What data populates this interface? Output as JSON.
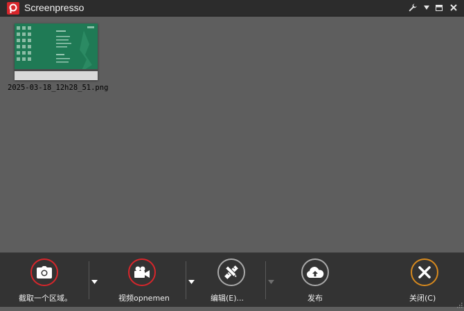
{
  "window": {
    "title": "Screenpresso"
  },
  "title_icons": {
    "logo": "screenpresso-logo-icon",
    "settings": "wrench-icon",
    "menu": "dropdown-arrow-icon",
    "restore": "window-restore-icon",
    "close": "close-icon"
  },
  "gallery": {
    "items": [
      {
        "filename": "2025-03-18_12h28_51.png"
      }
    ]
  },
  "toolbar": {
    "capture_label": "截取一个区域。",
    "video_label": "视频opnemen",
    "edit_label": "编辑(E)...",
    "publish_label": "发布",
    "close_label": "关闭(C)"
  },
  "colors": {
    "accent_red": "#d8262b",
    "accent_orange": "#d88a1e",
    "neutral_gray": "#aaaaaa",
    "background": "#5e5e5e",
    "toolbar_bg": "#333333"
  }
}
